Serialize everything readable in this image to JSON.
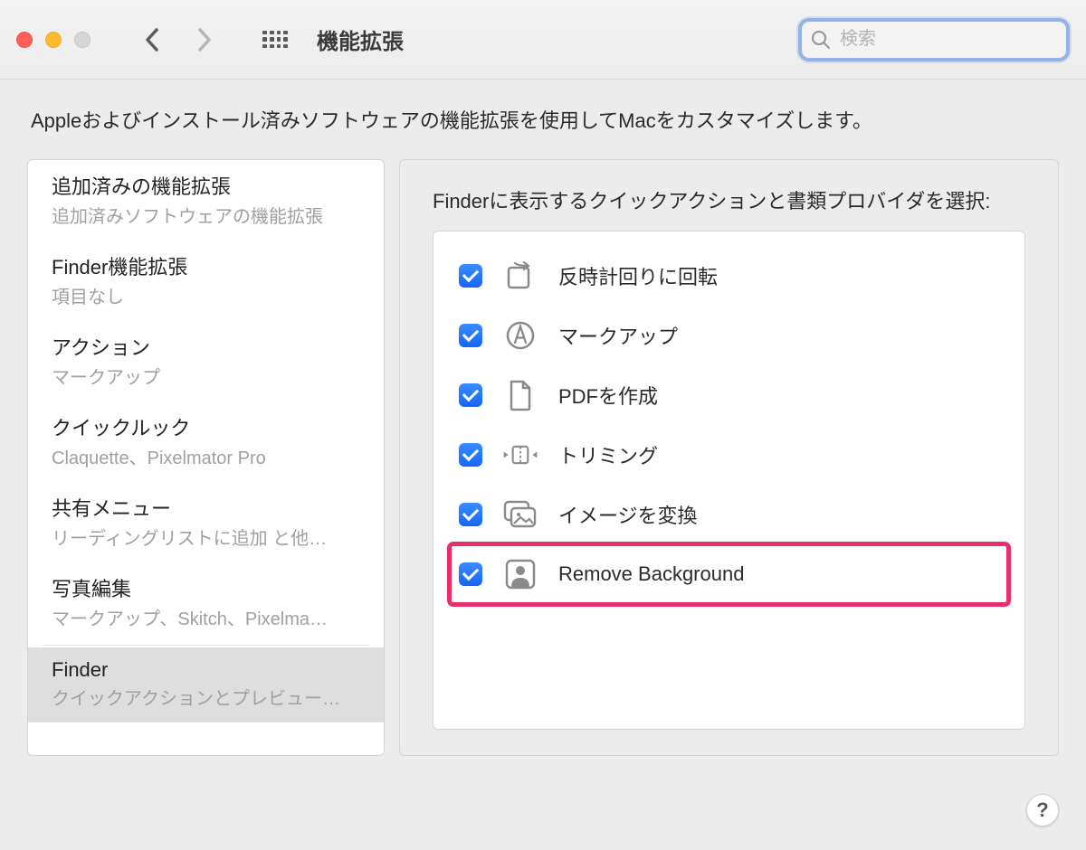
{
  "toolbar": {
    "window_title": "機能拡張",
    "search_placeholder": "検索"
  },
  "description": "Appleおよびインストール済みソフトウェアの機能拡張を使用してMacをカスタマイズします。",
  "sidebar": {
    "items": [
      {
        "title": "追加済みの機能拡張",
        "subtitle": "追加済みソフトウェアの機能拡張",
        "selected": false
      },
      {
        "title": "Finder機能拡張",
        "subtitle": "項目なし",
        "selected": false
      },
      {
        "title": "アクション",
        "subtitle": "マークアップ",
        "selected": false
      },
      {
        "title": "クイックルック",
        "subtitle": "Claquette、Pixelmator Pro",
        "selected": false
      },
      {
        "title": "共有メニュー",
        "subtitle": "リーディングリストに追加 と他…",
        "selected": false
      },
      {
        "title": "写真編集",
        "subtitle": "マークアップ、Skitch、Pixelma…",
        "selected": false
      },
      {
        "title": "Finder",
        "subtitle": "クイックアクションとプレビュー…",
        "selected": true
      }
    ]
  },
  "detail": {
    "heading": "Finderに表示するクイックアクションと書類プロバイダを選択:",
    "items": [
      {
        "label": "反時計回りに回転",
        "checked": true,
        "icon": "rotate-ccw-icon",
        "highlighted": false
      },
      {
        "label": "マークアップ",
        "checked": true,
        "icon": "markup-icon",
        "highlighted": false
      },
      {
        "label": "PDFを作成",
        "checked": true,
        "icon": "document-icon",
        "highlighted": false
      },
      {
        "label": "トリミング",
        "checked": true,
        "icon": "trim-icon",
        "highlighted": false
      },
      {
        "label": "イメージを変換",
        "checked": true,
        "icon": "convert-image-icon",
        "highlighted": false
      },
      {
        "label": "Remove Background",
        "checked": true,
        "icon": "person-crop-icon",
        "highlighted": true
      }
    ]
  },
  "help_label": "?"
}
